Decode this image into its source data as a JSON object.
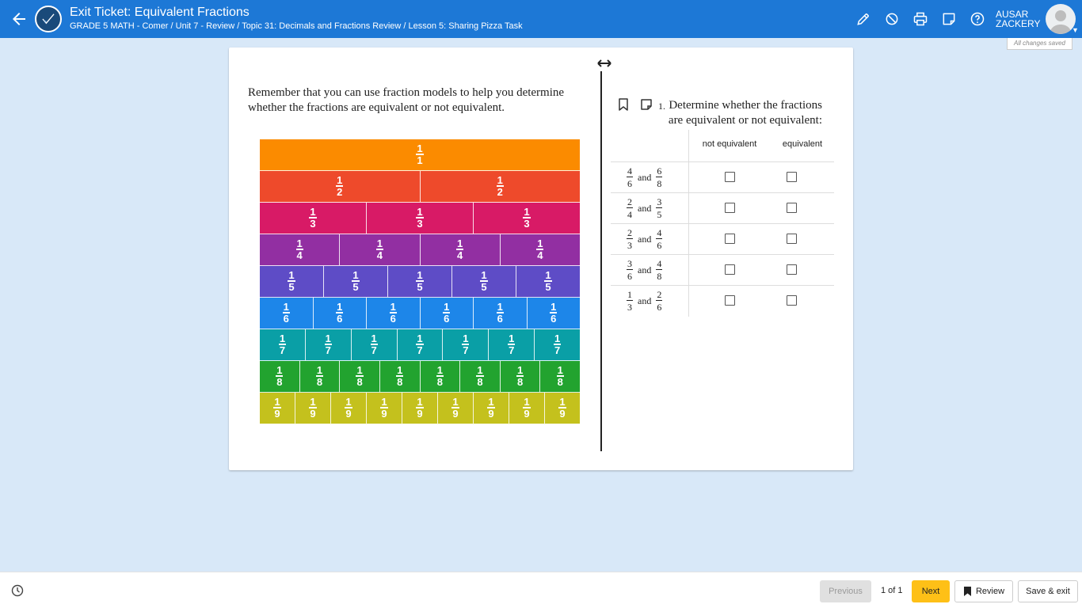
{
  "header": {
    "title": "Exit Ticket: Equivalent Fractions",
    "breadcrumb": "GRADE 5 MATH - Comer / Unit 7 - Review / Topic 31: Decimals and Fractions Review / Lesson 5: Sharing Pizza Task",
    "user_first": "AUSAR",
    "user_last": "ZACKERY",
    "save_status": "All changes saved",
    "tool_icons": [
      "pen-icon",
      "block-icon",
      "print-icon",
      "note-icon",
      "help-icon"
    ]
  },
  "passage": {
    "text": "Remember that you can use fraction models to help you determine whether the fractions are equivalent or not equivalent."
  },
  "fraction_bars": {
    "rows": [
      {
        "num": "1",
        "den": "1",
        "count": 1,
        "color": "#fb8b00"
      },
      {
        "num": "1",
        "den": "2",
        "count": 2,
        "color": "#ee4a2b"
      },
      {
        "num": "1",
        "den": "3",
        "count": 3,
        "color": "#d81a66"
      },
      {
        "num": "1",
        "den": "4",
        "count": 4,
        "color": "#922fa2"
      },
      {
        "num": "1",
        "den": "5",
        "count": 5,
        "color": "#5e4cc6"
      },
      {
        "num": "1",
        "den": "6",
        "count": 6,
        "color": "#1d86e9"
      },
      {
        "num": "1",
        "den": "7",
        "count": 7,
        "color": "#0a9fa6"
      },
      {
        "num": "1",
        "den": "8",
        "count": 8,
        "color": "#22a32f"
      },
      {
        "num": "1",
        "den": "9",
        "count": 9,
        "color": "#c4c11d"
      }
    ]
  },
  "question": {
    "number": "1.",
    "text": "Determine whether the fractions are equivalent or not equivalent:",
    "columns": [
      "not equivalent",
      "equivalent"
    ],
    "connector": "and",
    "rows": [
      {
        "a_num": "4",
        "a_den": "6",
        "b_num": "6",
        "b_den": "8"
      },
      {
        "a_num": "2",
        "a_den": "4",
        "b_num": "3",
        "b_den": "5"
      },
      {
        "a_num": "2",
        "a_den": "3",
        "b_num": "4",
        "b_den": "6"
      },
      {
        "a_num": "3",
        "a_den": "6",
        "b_num": "4",
        "b_den": "8"
      },
      {
        "a_num": "1",
        "a_den": "3",
        "b_num": "2",
        "b_den": "6"
      }
    ]
  },
  "footer": {
    "previous": "Previous",
    "page": "1 of 1",
    "next": "Next",
    "review": "Review",
    "save_exit": "Save & exit"
  }
}
